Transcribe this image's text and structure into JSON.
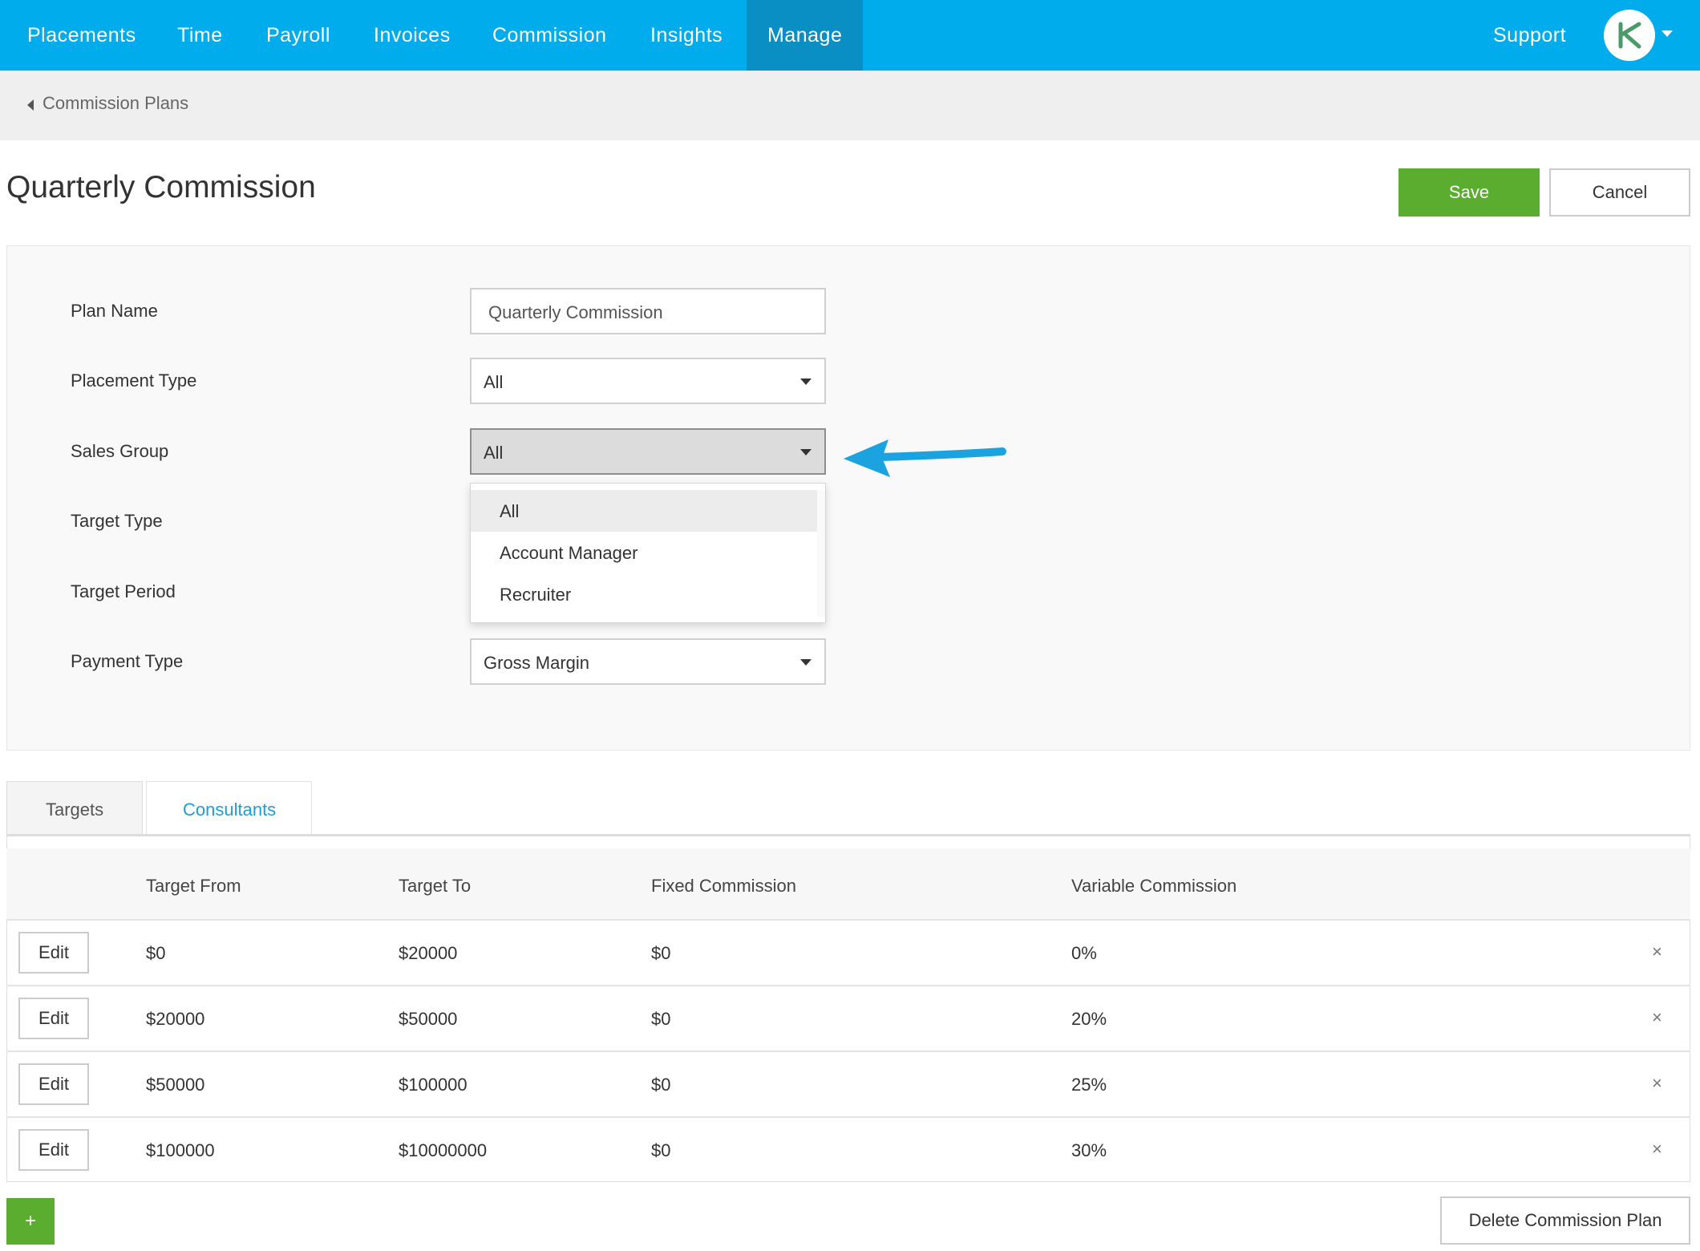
{
  "nav": {
    "items": [
      "Placements",
      "Time",
      "Payroll",
      "Invoices",
      "Commission",
      "Insights",
      "Manage"
    ],
    "active": "Manage",
    "support": "Support",
    "avatar_icon": "kelsi-logo-icon",
    "avatar_menu_icon": "caret-down-icon"
  },
  "breadcrumb": {
    "label": "Commission Plans",
    "icon": "caret-left-icon"
  },
  "page": {
    "title": "Quarterly Commission"
  },
  "actions": {
    "save": "Save",
    "cancel": "Cancel"
  },
  "form": {
    "plan_name": {
      "label": "Plan Name",
      "value": "Quarterly Commission"
    },
    "placement_type": {
      "label": "Placement Type",
      "value": "All"
    },
    "sales_group": {
      "label": "Sales Group",
      "value": "All",
      "options": [
        "All",
        "Account Manager",
        "Recruiter"
      ],
      "selected": "All",
      "open": true
    },
    "target_type": {
      "label": "Target Type"
    },
    "target_period": {
      "label": "Target Period"
    },
    "payment_type": {
      "label": "Payment Type",
      "value": "Gross Margin"
    }
  },
  "tabs": {
    "targets": "Targets",
    "consultants": "Consultants",
    "active": "Targets"
  },
  "table": {
    "headers": [
      "Target From",
      "Target To",
      "Fixed Commission",
      "Variable Commission"
    ],
    "rows": [
      {
        "edit": "Edit",
        "from": "$0",
        "to": "$20000",
        "fixed": "$0",
        "variable": "0%",
        "remove": "×"
      },
      {
        "edit": "Edit",
        "from": "$20000",
        "to": "$50000",
        "fixed": "$0",
        "variable": "20%",
        "remove": "×"
      },
      {
        "edit": "Edit",
        "from": "$50000",
        "to": "$100000",
        "fixed": "$0",
        "variable": "25%",
        "remove": "×"
      },
      {
        "edit": "Edit",
        "from": "$100000",
        "to": "$10000000",
        "fixed": "$0",
        "variable": "30%",
        "remove": "×"
      }
    ]
  },
  "footer": {
    "add": "+",
    "delete": "Delete Commission Plan"
  },
  "colors": {
    "nav": "#00aceb",
    "nav_active": "#0a8fc4",
    "primary_green": "#5aad2f",
    "link_blue": "#1a9fd8",
    "annotation_arrow": "#1aa3e0"
  }
}
